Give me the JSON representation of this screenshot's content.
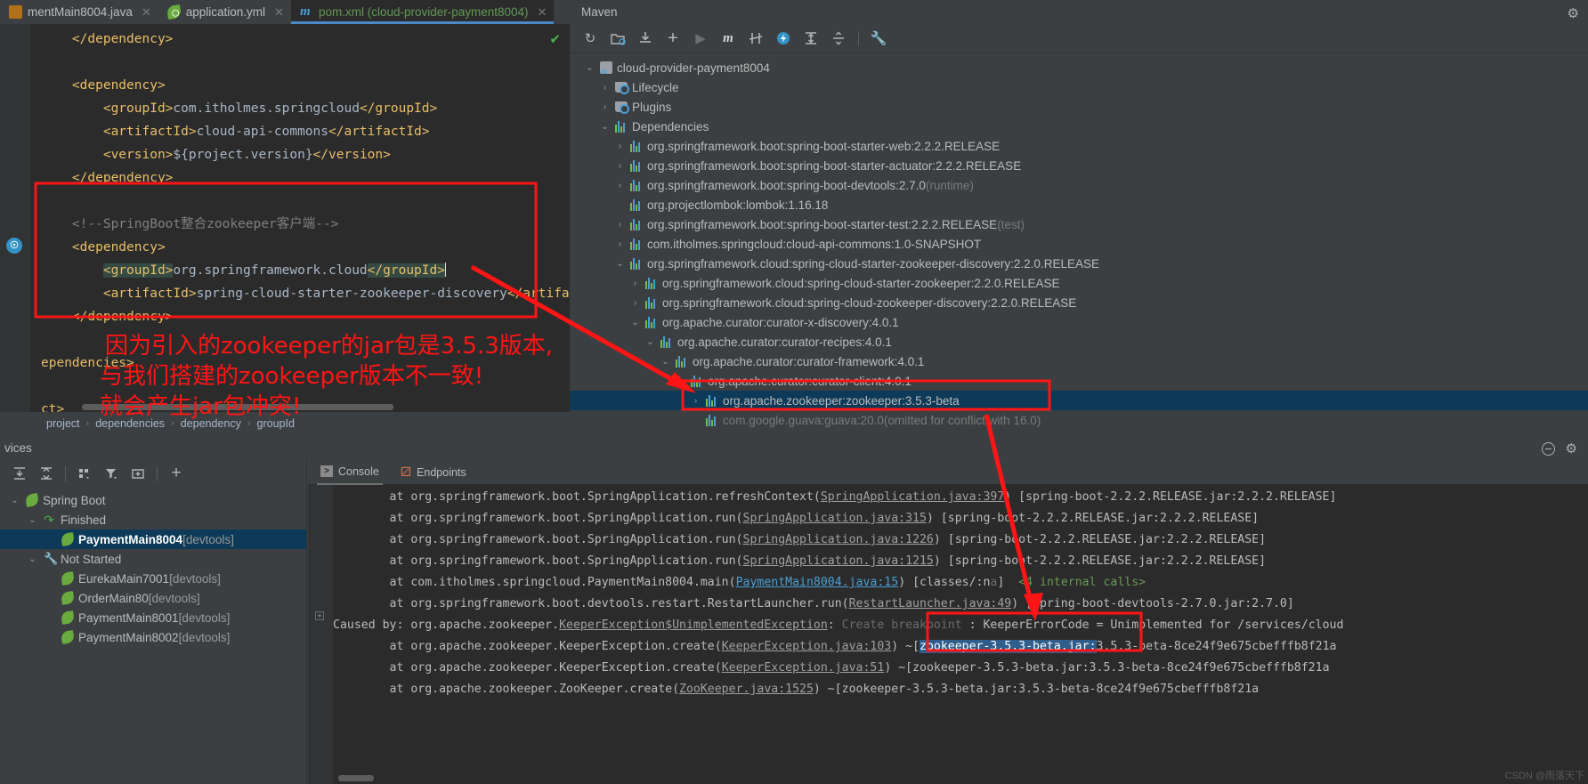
{
  "editor": {
    "tabs": [
      {
        "label": "mentMain8004.java",
        "icon": "java-file-icon",
        "selected": false,
        "closable": true
      },
      {
        "label": "application.yml",
        "icon": "spring-leaf-icon",
        "selected": false,
        "closable": true
      },
      {
        "label": "pom.xml (cloud-provider-payment8004)",
        "icon": "maven-m-icon",
        "selected": true,
        "closable": true
      }
    ],
    "inspection_status": "✔",
    "code_lines": [
      {
        "indent": 1,
        "parts": [
          {
            "t": "</dependency>",
            "c": "tagc"
          }
        ]
      },
      {
        "indent": 1,
        "parts": []
      },
      {
        "indent": 1,
        "parts": [
          {
            "t": "<dependency>",
            "c": "tagc"
          }
        ]
      },
      {
        "indent": 2,
        "parts": [
          {
            "t": "<groupId>",
            "c": "tagc"
          },
          {
            "t": "com.itholmes.springcloud",
            "c": "txtc"
          },
          {
            "t": "</groupId>",
            "c": "tagc"
          }
        ]
      },
      {
        "indent": 2,
        "parts": [
          {
            "t": "<artifactId>",
            "c": "tagc"
          },
          {
            "t": "cloud-api-commons",
            "c": "txtc"
          },
          {
            "t": "</artifactId>",
            "c": "tagc"
          }
        ]
      },
      {
        "indent": 2,
        "parts": [
          {
            "t": "<version>",
            "c": "tagc"
          },
          {
            "t": "${project.version}",
            "c": "txtc"
          },
          {
            "t": "</version>",
            "c": "tagc"
          }
        ]
      },
      {
        "indent": 1,
        "parts": [
          {
            "t": "</dependency>",
            "c": "tagc"
          }
        ]
      },
      {
        "indent": 1,
        "parts": []
      },
      {
        "indent": 1,
        "parts": [
          {
            "t": "<!--SpringBoot整合zookeeper客户端-->",
            "c": "cmt"
          }
        ]
      },
      {
        "indent": 1,
        "parts": [
          {
            "t": "<dependency>",
            "c": "tagc"
          }
        ]
      },
      {
        "indent": 2,
        "parts": [
          {
            "t": "<groupId>",
            "c": "tagc hl"
          },
          {
            "t": "org.springframework.cloud",
            "c": "txtc"
          },
          {
            "t": "</groupId>",
            "c": "tagc hl"
          }
        ]
      },
      {
        "indent": 2,
        "parts": [
          {
            "t": "<artifactId>",
            "c": "tagc"
          },
          {
            "t": "spring-cloud-starter-zookeeper-discovery",
            "c": "txtc"
          },
          {
            "t": "</artifactId",
            "c": "tagc"
          }
        ]
      },
      {
        "indent": 1,
        "parts": [
          {
            "t": "</dependency>",
            "c": "tagc"
          }
        ]
      },
      {
        "indent": 0,
        "parts": []
      },
      {
        "indent": 0,
        "parts": [
          {
            "t": "ependencies>",
            "c": "tagc"
          }
        ]
      },
      {
        "indent": 0,
        "parts": []
      },
      {
        "indent": 0,
        "parts": [
          {
            "t": "ct>",
            "c": "tagc"
          }
        ]
      }
    ],
    "breadcrumb": [
      "project",
      "dependencies",
      "dependency",
      "groupId"
    ]
  },
  "maven": {
    "title": "Maven",
    "toolbar_icons": [
      "refresh-icon",
      "add-maven-project-icon",
      "download-sources-icon",
      "add-icon",
      "run-icon",
      "execute-maven-goal-icon",
      "toggle-skip-tests-icon",
      "toggle-offline-mode-icon",
      "expand-all-icon",
      "collapse-all-icon",
      "settings-wrench-icon"
    ],
    "gear_icon": "gear-icon",
    "tree": [
      {
        "depth": 0,
        "arrow": "v",
        "icon": "maven-module-icon",
        "label": "cloud-provider-payment8004",
        "suffix": "",
        "selected": false
      },
      {
        "depth": 1,
        "arrow": ">",
        "icon": "lifecycle-folder-icon",
        "label": "Lifecycle",
        "suffix": "",
        "selected": false
      },
      {
        "depth": 1,
        "arrow": ">",
        "icon": "plugins-folder-icon",
        "label": "Plugins",
        "suffix": "",
        "selected": false
      },
      {
        "depth": 1,
        "arrow": "v",
        "icon": "dependencies-icon",
        "label": "Dependencies",
        "suffix": "",
        "selected": false
      },
      {
        "depth": 2,
        "arrow": ">",
        "icon": "dependency-icon",
        "label": "org.springframework.boot:spring-boot-starter-web:2.2.2.RELEASE",
        "suffix": "",
        "selected": false
      },
      {
        "depth": 2,
        "arrow": ">",
        "icon": "dependency-icon",
        "label": "org.springframework.boot:spring-boot-starter-actuator:2.2.2.RELEASE",
        "suffix": "",
        "selected": false
      },
      {
        "depth": 2,
        "arrow": ">",
        "icon": "dependency-icon",
        "label": "org.springframework.boot:spring-boot-devtools:2.7.0",
        "suffix": " (runtime)",
        "selected": false
      },
      {
        "depth": 2,
        "arrow": "",
        "icon": "dependency-icon",
        "label": "org.projectlombok:lombok:1.16.18",
        "suffix": "",
        "selected": false
      },
      {
        "depth": 2,
        "arrow": ">",
        "icon": "dependency-icon",
        "label": "org.springframework.boot:spring-boot-starter-test:2.2.2.RELEASE",
        "suffix": " (test)",
        "selected": false
      },
      {
        "depth": 2,
        "arrow": ">",
        "icon": "dependency-icon",
        "label": "com.itholmes.springcloud:cloud-api-commons:1.0-SNAPSHOT",
        "suffix": "",
        "selected": false
      },
      {
        "depth": 2,
        "arrow": "v",
        "icon": "dependency-icon",
        "label": "org.springframework.cloud:spring-cloud-starter-zookeeper-discovery:2.2.0.RELEASE",
        "suffix": "",
        "selected": false
      },
      {
        "depth": 3,
        "arrow": ">",
        "icon": "dependency-icon",
        "label": "org.springframework.cloud:spring-cloud-starter-zookeeper:2.2.0.RELEASE",
        "suffix": "",
        "selected": false
      },
      {
        "depth": 3,
        "arrow": ">",
        "icon": "dependency-icon",
        "label": "org.springframework.cloud:spring-cloud-zookeeper-discovery:2.2.0.RELEASE",
        "suffix": "",
        "selected": false
      },
      {
        "depth": 3,
        "arrow": "v",
        "icon": "dependency-icon",
        "label": "org.apache.curator:curator-x-discovery:4.0.1",
        "suffix": "",
        "selected": false
      },
      {
        "depth": 4,
        "arrow": "v",
        "icon": "dependency-icon",
        "label": "org.apache.curator:curator-recipes:4.0.1",
        "suffix": "",
        "selected": false
      },
      {
        "depth": 5,
        "arrow": "v",
        "icon": "dependency-icon",
        "label": "org.apache.curator:curator-framework:4.0.1",
        "suffix": "",
        "selected": false
      },
      {
        "depth": 6,
        "arrow": "v",
        "icon": "dependency-icon",
        "label": "org.apache.curator:curator-client:4.0.1",
        "suffix": "",
        "selected": false
      },
      {
        "depth": 7,
        "arrow": ">",
        "icon": "dependency-icon",
        "label": "org.apache.zookeeper:zookeeper:3.5.3-beta",
        "suffix": "",
        "selected": true
      },
      {
        "depth": 7,
        "arrow": "",
        "icon": "dependency-icon",
        "label": "com.google.guava:guava:20.0",
        "suffix": " (omitted for conflict with 16.0)",
        "dim": true,
        "selected": false
      }
    ]
  },
  "services": {
    "title": "vices",
    "toolbar_icons": [
      "expand-all-icon",
      "collapse-all-icon",
      "group-by-icon",
      "filter-icon",
      "add-tab-icon",
      "add-service-icon"
    ],
    "header_icons": [
      "help-circle-icon",
      "settings-gear-icon"
    ],
    "tree": [
      {
        "depth": 0,
        "arrow": "v",
        "icon": "spring-leaf-icon",
        "label": "Spring Boot",
        "suffix": "",
        "bold": false,
        "selected": false
      },
      {
        "depth": 1,
        "arrow": "v",
        "icon": "finished-rerun-icon",
        "label": "Finished",
        "suffix": "",
        "bold": false,
        "selected": false
      },
      {
        "depth": 2,
        "arrow": "",
        "icon": "spring-leaf-icon",
        "label": "PaymentMain8004",
        "suffix": " [devtools]",
        "bold": true,
        "selected": true
      },
      {
        "depth": 1,
        "arrow": "v",
        "icon": "wrench-icon",
        "label": "Not Started",
        "suffix": "",
        "bold": false,
        "selected": false
      },
      {
        "depth": 2,
        "arrow": "",
        "icon": "spring-leaf-icon",
        "label": "EurekaMain7001",
        "suffix": " [devtools]",
        "bold": false,
        "selected": false
      },
      {
        "depth": 2,
        "arrow": "",
        "icon": "spring-leaf-icon",
        "label": "OrderMain80",
        "suffix": " [devtools]",
        "bold": false,
        "selected": false
      },
      {
        "depth": 2,
        "arrow": "",
        "icon": "spring-leaf-icon",
        "label": "PaymentMain8001",
        "suffix": " [devtools]",
        "bold": false,
        "selected": false
      },
      {
        "depth": 2,
        "arrow": "",
        "icon": "spring-leaf-icon",
        "label": "PaymentMain8002",
        "suffix": " [devtools]",
        "bold": false,
        "selected": false
      }
    ]
  },
  "console": {
    "tabs": [
      {
        "label": "Console",
        "icon": "console-icon",
        "active": true
      },
      {
        "label": "Endpoints",
        "icon": "endpoints-icon",
        "active": false
      }
    ],
    "lines": [
      [
        {
          "t": "        at org.springframework.boot.SpringApplication.refreshContext(",
          "c": ""
        },
        {
          "t": "SpringApplication.java:397",
          "c": "clink"
        },
        {
          "t": ") [spring-boot-2.2.2.RELEASE.jar:2.2.2.RELEASE]",
          "c": ""
        }
      ],
      [
        {
          "t": "        at org.springframework.boot.SpringApplication.run(",
          "c": ""
        },
        {
          "t": "SpringApplication.java:315",
          "c": "clink"
        },
        {
          "t": ") [spring-boot-2.2.2.RELEASE.jar:2.2.2.RELEASE]",
          "c": ""
        }
      ],
      [
        {
          "t": "        at org.springframework.boot.SpringApplication.run(",
          "c": ""
        },
        {
          "t": "SpringApplication.java:1226",
          "c": "clink"
        },
        {
          "t": ") [spring-boot-2.2.2.RELEASE.jar:2.2.2.RELEASE]",
          "c": ""
        }
      ],
      [
        {
          "t": "        at org.springframework.boot.SpringApplication.run(",
          "c": ""
        },
        {
          "t": "SpringApplication.java:1215",
          "c": "clink"
        },
        {
          "t": ") [spring-boot-2.2.2.RELEASE.jar:2.2.2.RELEASE]",
          "c": ""
        }
      ],
      [
        {
          "t": "        at com.itholmes.springcloud.PaymentMain8004.main(",
          "c": ""
        },
        {
          "t": "PaymentMain8004.java:15",
          "c": "clink b"
        },
        {
          "t": ") [classes/:n",
          "c": ""
        },
        {
          "t": "a",
          "c": "chint"
        },
        {
          "t": "]  ",
          "c": ""
        },
        {
          "t": "<4 internal calls>",
          "c": "cgreen"
        }
      ],
      [
        {
          "t": "        at org.springframework.boot.devtools.restart.RestartLauncher.run(",
          "c": ""
        },
        {
          "t": "RestartLauncher.java:49",
          "c": "clink"
        },
        {
          "t": ") [spring-boot-devtools-2.7.0.jar:2.7.0]",
          "c": ""
        }
      ],
      [
        {
          "t": "Caused by: org.apache.zookeeper.",
          "c": ""
        },
        {
          "t": "KeeperException$UnimplementedException",
          "c": "clink"
        },
        {
          "t": ": ",
          "c": ""
        },
        {
          "t": "Create breakpoint",
          "c": "chint"
        },
        {
          "t": " : KeeperErrorCode = Unimplemented for /services/cloud",
          "c": ""
        }
      ],
      [
        {
          "t": "        at org.apache.zookeeper.KeeperException.create(",
          "c": ""
        },
        {
          "t": "KeeperException.java:103",
          "c": "clink"
        },
        {
          "t": ") ~[",
          "c": ""
        },
        {
          "t": "zookeeper-3.5.3-beta.jar:",
          "c": "selblue"
        },
        {
          "t": "3.5.3-beta-8ce24f9e675cbefffb8f21a",
          "c": ""
        }
      ],
      [
        {
          "t": "        at org.apache.zookeeper.KeeperException.create(",
          "c": ""
        },
        {
          "t": "KeeperException.java:51",
          "c": "clink"
        },
        {
          "t": ") ~[zookeeper-3.5.3-beta.jar:3.5.3-beta-8ce24f9e675cbefffb8f21a",
          "c": ""
        }
      ],
      [
        {
          "t": "        at org.apache.zookeeper.ZooKeeper.create(",
          "c": ""
        },
        {
          "t": "ZooKeeper.java:1525",
          "c": "clink"
        },
        {
          "t": ") ~[zookeeper-3.5.3-beta.jar:3.5.3-beta-8ce24f9e675cbefffb8f21a",
          "c": ""
        }
      ]
    ],
    "watermark": "CSDN @雨落天下"
  },
  "annotations": {
    "note_lines": [
      "因为引入的zookeeper的jar包是3.5.3版本,",
      "与我们搭建的zookeeper版本不一致!",
      "就会产生jar包冲突!"
    ],
    "accent_color": "#ff1515",
    "boxes": [
      "pom-dependency-highlight-box",
      "maven-zookeeper-highlight-box",
      "console-jar-highlight-box"
    ],
    "arrows": [
      "arrow-pom-to-maven-tree",
      "arrow-maven-tree-to-console"
    ]
  }
}
